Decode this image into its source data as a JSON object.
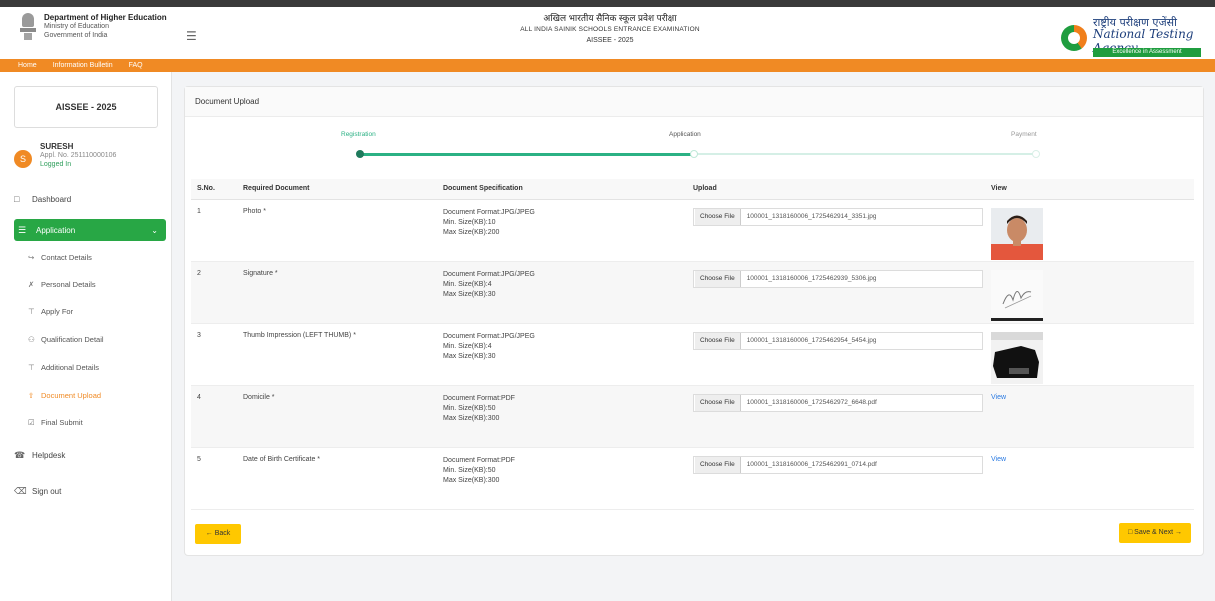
{
  "header": {
    "dept_line1": "Department of Higher Education",
    "dept_line2": "Ministry of Education",
    "dept_line3": "Government of India",
    "title_hindi": "अखिल भारतीय सैनिक स्कूल प्रवेश परीक्षा",
    "title_english": "ALL INDIA SAINIK SCHOOLS ENTRANCE EXAMINATION",
    "session": "AISSEE - 2025",
    "nta_hindi": "राष्ट्रीय परीक्षण एजेंसी",
    "nta_english": "National Testing Agency",
    "nta_tagline": "Excellence in Assessment"
  },
  "navbar": {
    "items": [
      "Home",
      "Information Bulletin",
      "FAQ"
    ]
  },
  "sidebar": {
    "session_label": "AISSEE - 2025",
    "user": {
      "avatar_letter": "S",
      "name": "SURESH",
      "id": "Appl. No. 251110000106",
      "status": "Logged In"
    },
    "dashboard": "Dashboard",
    "application": "Application",
    "sub_items": [
      "Contact Details",
      "Personal Details",
      "Apply For",
      "Qualification Detail",
      "Additional Details",
      "Document Upload",
      "Final Submit"
    ],
    "helpdesk": "Helpdesk",
    "signout": "Sign out"
  },
  "card": {
    "title": "Document Upload",
    "steps": [
      "Registration",
      "Application",
      "Payment"
    ],
    "columns": [
      "S.No.",
      "Required Document",
      "Document Specification",
      "Upload",
      "View"
    ],
    "rows": [
      {
        "sno": "1",
        "doc": "Photo *",
        "spec1": "Document Format:JPG/JPEG",
        "spec2": "Min. Size(KB):10",
        "spec3": "Max Size(KB):200",
        "choose": "Choose File",
        "file": "100001_1318160006_1725462914_3351.jpg",
        "view": ""
      },
      {
        "sno": "2",
        "doc": "Signature *",
        "spec1": "Document Format:JPG/JPEG",
        "spec2": "Min. Size(KB):4",
        "spec3": "Max Size(KB):30",
        "choose": "Choose File",
        "file": "100001_1318160006_1725462939_5306.jpg",
        "view": ""
      },
      {
        "sno": "3",
        "doc": "Thumb Impression (LEFT THUMB) *",
        "spec1": "Document Format:JPG/JPEG",
        "spec2": "Min. Size(KB):4",
        "spec3": "Max Size(KB):30",
        "choose": "Choose File",
        "file": "100001_1318160006_1725462954_5454.jpg",
        "view": ""
      },
      {
        "sno": "4",
        "doc": "Domicile *",
        "spec1": "Document Format:PDF",
        "spec2": "Min. Size(KB):50",
        "spec3": "Max Size(KB):300",
        "choose": "Choose File",
        "file": "100001_1318160006_1725462972_6648.pdf",
        "view": "View"
      },
      {
        "sno": "5",
        "doc": "Date of Birth Certificate *",
        "spec1": "Document Format:PDF",
        "spec2": "Min. Size(KB):50",
        "spec3": "Max Size(KB):300",
        "choose": "Choose File",
        "file": "100001_1318160006_1725462991_0714.pdf",
        "view": "View"
      }
    ],
    "back_label": "Back",
    "next_label": "Save & Next"
  },
  "colors": {
    "accent_orange": "#f08a24",
    "active_green": "#28a745",
    "progress_green": "#2bb184",
    "button_yellow": "#ffc800"
  }
}
